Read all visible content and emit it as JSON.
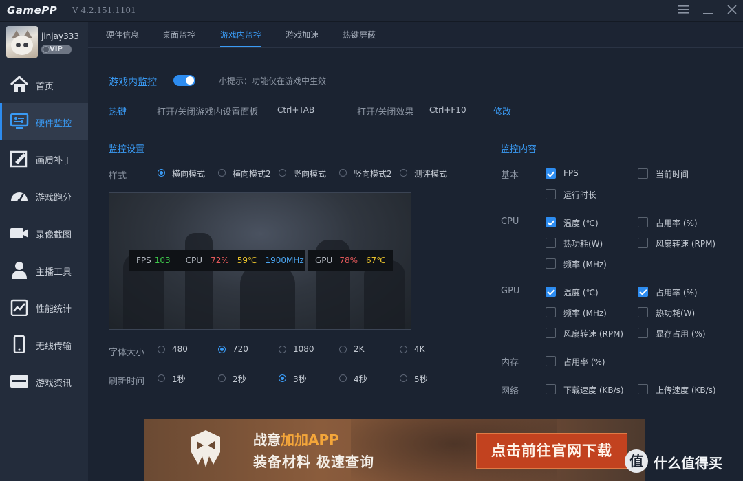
{
  "app": {
    "logo": "GamePP",
    "version": "V 4.2.151.1101"
  },
  "user": {
    "name": "jinjay333",
    "badge": "VIP"
  },
  "sidebar": {
    "items": [
      {
        "label": "首页",
        "icon": "home-icon"
      },
      {
        "label": "硬件监控",
        "icon": "hardware-monitor-icon",
        "active": true
      },
      {
        "label": "画质补丁",
        "icon": "quality-patch-icon"
      },
      {
        "label": "游戏跑分",
        "icon": "benchmark-gauge-icon"
      },
      {
        "label": "录像截图",
        "icon": "video-camera-icon"
      },
      {
        "label": "主播工具",
        "icon": "streamer-icon"
      },
      {
        "label": "性能统计",
        "icon": "stats-chart-icon"
      },
      {
        "label": "无线传输",
        "icon": "phone-icon"
      },
      {
        "label": "游戏资讯",
        "icon": "news-icon"
      }
    ]
  },
  "tabs": [
    {
      "label": "硬件信息"
    },
    {
      "label": "桌面监控"
    },
    {
      "label": "游戏内监控",
      "active": true
    },
    {
      "label": "游戏加速"
    },
    {
      "label": "热键屏蔽"
    }
  ],
  "header": {
    "title": "游戏内监控",
    "toggle_on": true,
    "tip": "小提示：功能仅在游戏中生效"
  },
  "hotkeys": {
    "label": "热键",
    "panel_label": "打开/关闭游戏内设置面板",
    "panel_key": "Ctrl+TAB",
    "effect_label": "打开/关闭效果",
    "effect_key": "Ctrl+F10",
    "edit": "修改"
  },
  "monitor_settings": {
    "title": "监控设置",
    "style_label": "样式",
    "styles": [
      "横向模式",
      "横向模式2",
      "竖向模式",
      "竖向模式2",
      "测评模式"
    ],
    "style_selected": 0,
    "font_label": "字体大小",
    "fonts": [
      "480",
      "720",
      "1080",
      "2K",
      "4K"
    ],
    "font_selected": 1,
    "refresh_label": "刷新时间",
    "refresh": [
      "1秒",
      "2秒",
      "3秒",
      "4秒",
      "5秒"
    ],
    "refresh_selected": 2
  },
  "preview": {
    "fps_label": "FPS",
    "fps": "103",
    "cpu_label": "CPU",
    "cpu_usage": "72%",
    "cpu_temp": "59℃",
    "cpu_freq": "1900MHz",
    "gpu_label": "GPU",
    "gpu_usage": "78%",
    "gpu_temp": "67℃"
  },
  "monitor_content": {
    "title": "监控内容",
    "basic_label": "基本",
    "basic": [
      {
        "label": "FPS",
        "checked": true
      },
      {
        "label": "当前时间",
        "checked": false
      },
      {
        "label": "运行时长",
        "checked": false
      }
    ],
    "cpu_label": "CPU",
    "cpu": [
      {
        "label": "温度 (℃)",
        "checked": true
      },
      {
        "label": "占用率 (%)",
        "checked": false
      },
      {
        "label": "热功耗(W)",
        "checked": false
      },
      {
        "label": "风扇转速 (RPM)",
        "checked": false
      },
      {
        "label": "频率 (MHz)",
        "checked": false
      }
    ],
    "gpu_label": "GPU",
    "gpu": [
      {
        "label": "温度 (℃)",
        "checked": true
      },
      {
        "label": "占用率 (%)",
        "checked": true
      },
      {
        "label": "频率 (MHz)",
        "checked": false
      },
      {
        "label": "热功耗(W)",
        "checked": false
      },
      {
        "label": "风扇转速 (RPM)",
        "checked": false
      },
      {
        "label": "显存占用 (%)",
        "checked": false
      }
    ],
    "mem_label": "内存",
    "mem": [
      {
        "label": "占用率 (%)",
        "checked": false
      }
    ],
    "net_label": "网络",
    "net": [
      {
        "label": "下载速度 (KB/s)",
        "checked": false
      },
      {
        "label": "上传速度 (KB/s)",
        "checked": false
      }
    ]
  },
  "banner": {
    "title_a": "战意",
    "title_b": "加加APP",
    "subtitle": "装备材料  极速查询",
    "button": "点击前往官网下载"
  },
  "watermark": {
    "symbol": "值",
    "text": "什么值得买"
  },
  "colors": {
    "accent": "#2d8cf0",
    "fps": "#3ecb4b",
    "usage": "#e4585a",
    "temp": "#e9c22b",
    "freq": "#4aa4f0"
  }
}
